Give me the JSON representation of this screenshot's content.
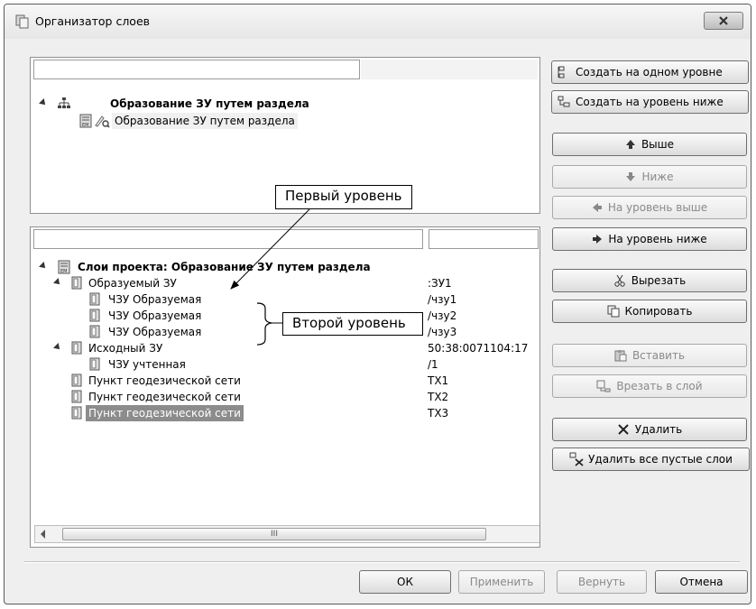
{
  "window": {
    "title": "Организатор слоев"
  },
  "top_panel": {
    "filter_value": "",
    "root": {
      "label": "Образование ЗУ путем раздела"
    },
    "child": {
      "label": "Образование ЗУ путем раздела"
    }
  },
  "bottom_panel": {
    "filter_value": "",
    "filter2_value": "",
    "root": {
      "label": "Слои проекта: Образование ЗУ путем раздела"
    },
    "rows": [
      {
        "label": "Образуемый ЗУ",
        "value": ":ЗУ1"
      },
      {
        "label": "ЧЗУ Образуемая",
        "value": "/чзу1"
      },
      {
        "label": "ЧЗУ Образуемая",
        "value": "/чзу2"
      },
      {
        "label": "ЧЗУ Образуемая",
        "value": "/чзу3"
      },
      {
        "label": "Исходный ЗУ",
        "value": "50:38:0071104:17"
      },
      {
        "label": "ЧЗУ учтенная",
        "value": "/1"
      },
      {
        "label": "Пункт геодезической сети",
        "value": "ТХ1"
      },
      {
        "label": "Пункт геодезической сети",
        "value": "ТХ2"
      },
      {
        "label": "Пункт геодезической сети",
        "value": "ТХ3"
      }
    ],
    "scroll_thumb_label": "III"
  },
  "annotations": {
    "first_level": "Первый уровень",
    "second_level": "Второй уровень"
  },
  "side_buttons": {
    "create_same_level": "Создать на одном уровне",
    "create_level_below": "Создать на уровень ниже",
    "up": "Выше",
    "down": "Ниже",
    "level_up": "На уровень выше",
    "level_down": "На уровень ниже",
    "cut": "Вырезать",
    "copy": "Копировать",
    "paste": "Вставить",
    "cut_into_layer": "Врезать в слой",
    "delete": "Удалить",
    "delete_empty": "Удалить все пустые слои"
  },
  "footer": {
    "ok": "ОК",
    "apply": "Применить",
    "revert": "Вернуть",
    "cancel": "Отмена"
  }
}
